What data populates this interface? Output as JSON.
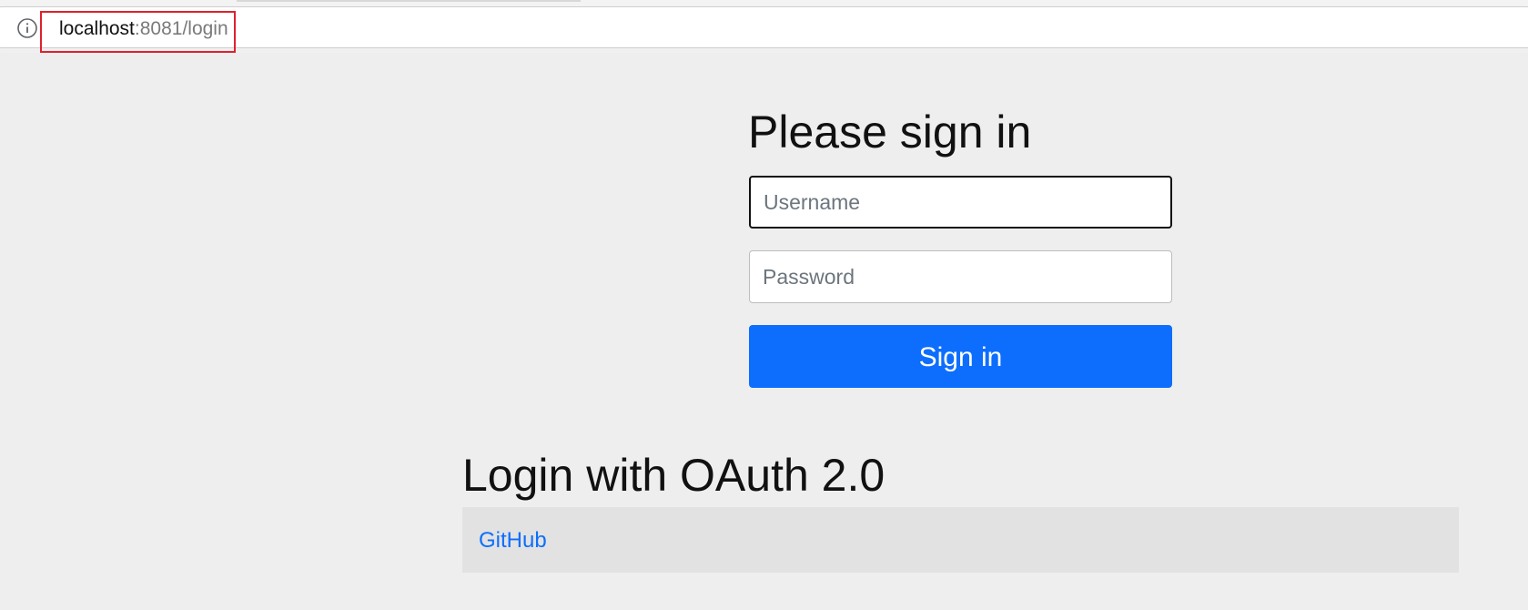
{
  "browser": {
    "url_host": "localhost",
    "url_path": ":8081/login",
    "info_icon": "info-icon"
  },
  "login_form": {
    "title": "Please sign in",
    "username_placeholder": "Username",
    "password_placeholder": "Password",
    "username_value": "",
    "password_value": "",
    "submit_label": "Sign in"
  },
  "oauth": {
    "title": "Login with OAuth 2.0",
    "providers": [
      {
        "label": "GitHub"
      }
    ]
  },
  "colors": {
    "page_background": "#eeeeee",
    "primary_button": "#0d6efd",
    "link": "#0d6efd",
    "url_highlight": "#e0202c",
    "oauth_table": "#e2e2e2"
  }
}
